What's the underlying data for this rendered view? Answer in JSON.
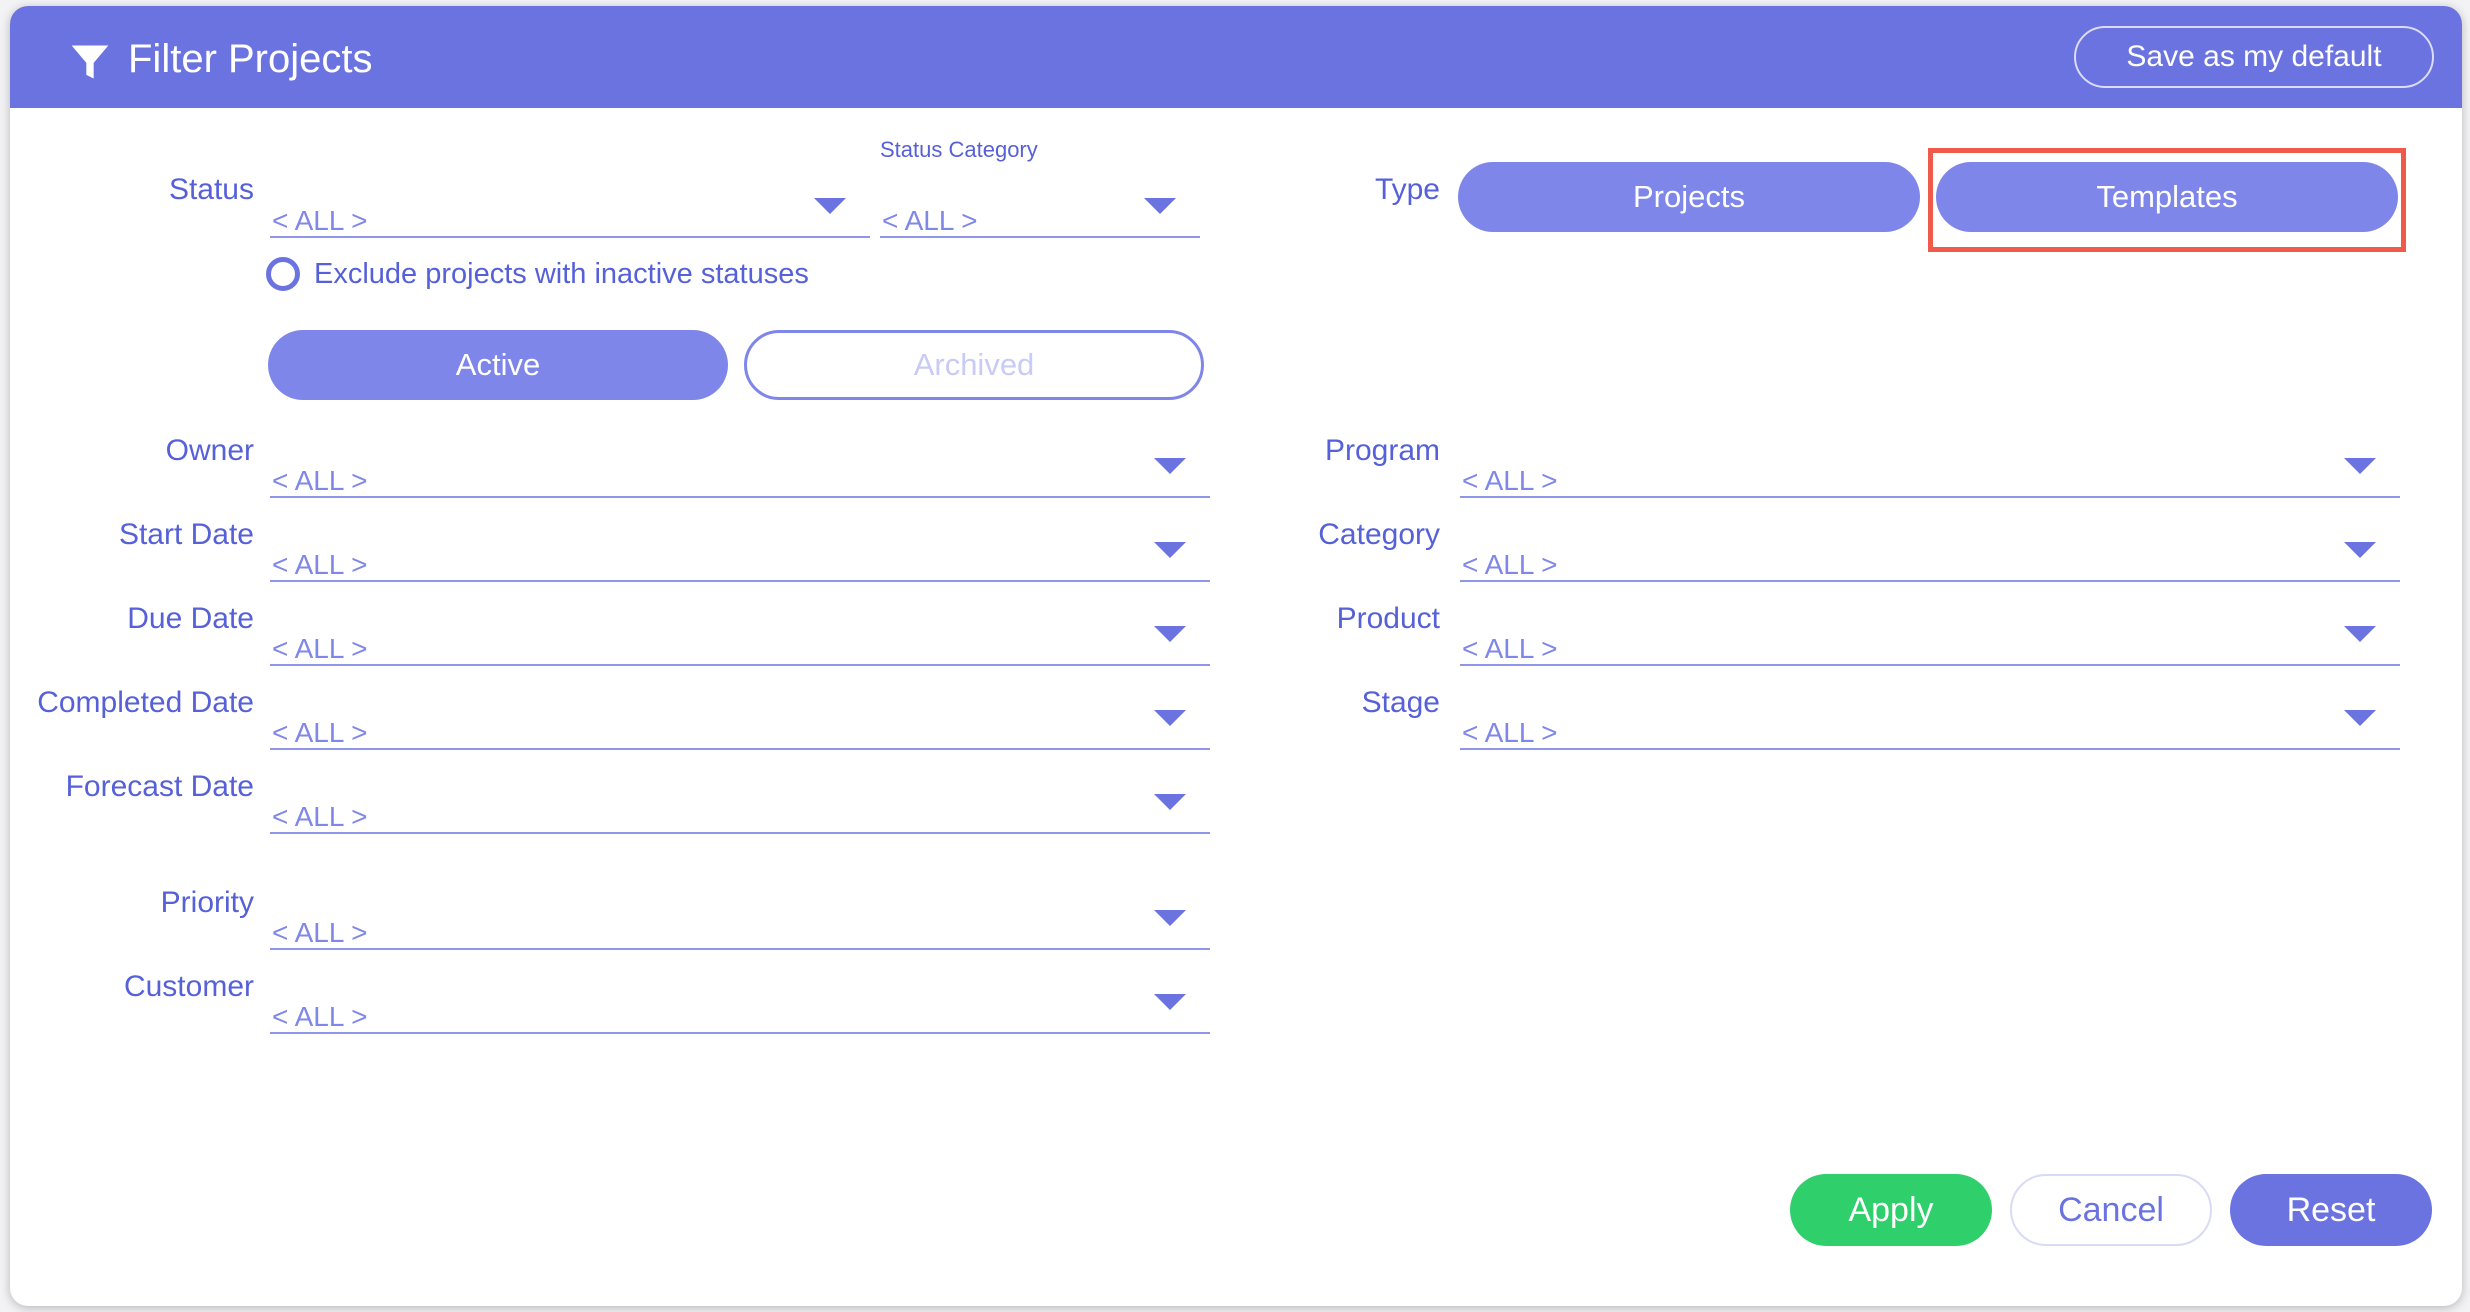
{
  "header": {
    "title": "Filter Projects",
    "icon": "filter-icon",
    "save_default_label": "Save as my default"
  },
  "status": {
    "label": "Status",
    "value": "< ALL >",
    "category_label": "Status Category",
    "category_value": "< ALL >",
    "exclude_inactive_label": "Exclude projects with inactive statuses",
    "exclude_inactive_checked": false
  },
  "state_toggle": {
    "active_label": "Active",
    "archived_label": "Archived",
    "selected": "Active"
  },
  "type": {
    "label": "Type",
    "projects_label": "Projects",
    "templates_label": "Templates"
  },
  "left_fields": [
    {
      "label": "Owner",
      "value": "< ALL >"
    },
    {
      "label": "Start Date",
      "value": "< ALL >"
    },
    {
      "label": "Due Date",
      "value": "< ALL >"
    },
    {
      "label": "Completed Date",
      "value": "< ALL >"
    },
    {
      "label": "Forecast Date",
      "value": "< ALL >"
    },
    {
      "label": "Priority",
      "value": "< ALL >"
    },
    {
      "label": "Customer",
      "value": "< ALL >"
    }
  ],
  "right_fields": [
    {
      "label": "Program",
      "value": "< ALL >"
    },
    {
      "label": "Category",
      "value": "< ALL >"
    },
    {
      "label": "Product",
      "value": "< ALL >"
    },
    {
      "label": "Stage",
      "value": "< ALL >"
    }
  ],
  "footer": {
    "apply_label": "Apply",
    "cancel_label": "Cancel",
    "reset_label": "Reset"
  },
  "colors": {
    "header": "#6b73e1",
    "accent": "#7f86ea",
    "apply": "#2fcf6b",
    "highlight": "#f05a4a"
  }
}
